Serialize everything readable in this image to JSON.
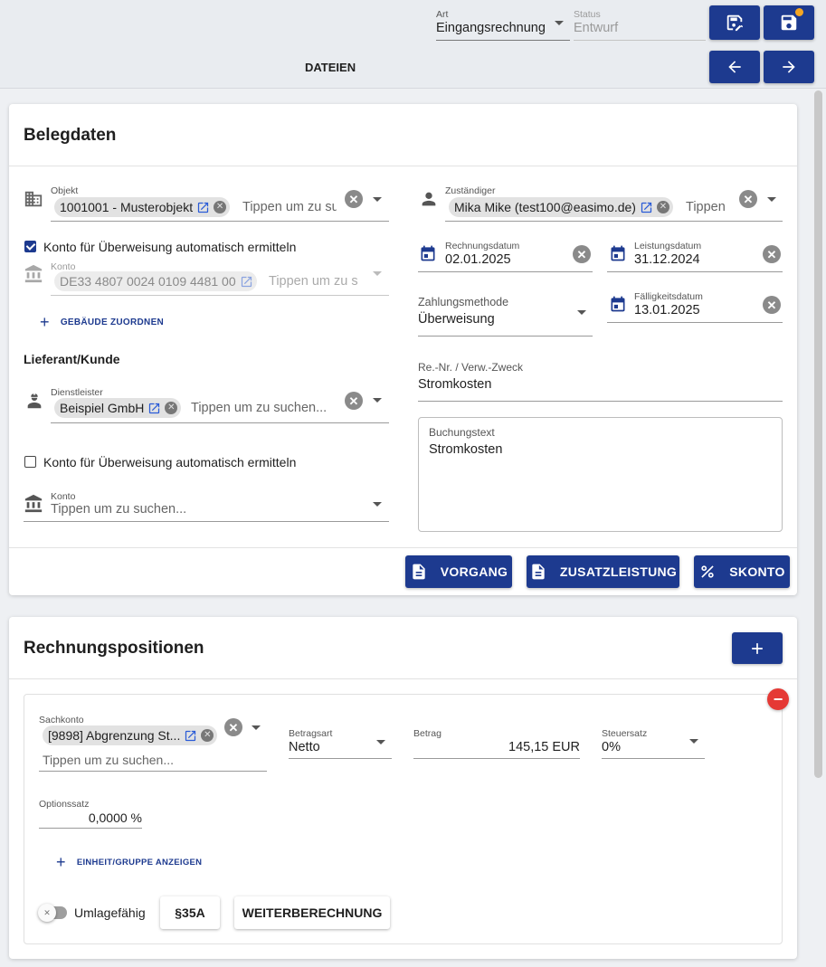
{
  "header": {
    "art_label": "Art",
    "art_value": "Eingangsrechnung",
    "status_label": "Status",
    "status_value": "Entwurf",
    "files_tab": "DATEIEN",
    "unsaved_indicator_color": "#f5a623"
  },
  "belegdaten": {
    "title": "Belegdaten",
    "objekt": {
      "label": "Objekt",
      "chip": "1001001 - Musterobjekt",
      "placeholder": "Tippen um zu su"
    },
    "auto_konto_1": {
      "label": "Konto für Überweisung automatisch ermitteln",
      "checked": true
    },
    "konto_1": {
      "label": "Konto",
      "chip": "DE33 4807 0024 0109 4481 00",
      "placeholder": "Tippen um zu s"
    },
    "gebaeude_btn": "GEBÄUDE ZUORDNEN",
    "lieferant_heading": "Lieferant/Kunde",
    "dienstleister": {
      "label": "Dienstleister",
      "chip": "Beispiel GmbH",
      "placeholder": "Tippen um zu suchen..."
    },
    "auto_konto_2": {
      "label": "Konto für Überweisung automatisch ermitteln",
      "checked": false
    },
    "konto_2": {
      "label": "Konto",
      "placeholder": "Tippen um zu suchen..."
    },
    "zustaendiger": {
      "label": "Zuständiger",
      "chip": "Mika Mike (test100@easimo.de)",
      "placeholder": "Tippen"
    },
    "rechnungsdatum": {
      "label": "Rechnungsdatum",
      "value": "02.01.2025"
    },
    "leistungsdatum": {
      "label": "Leistungsdatum",
      "value": "31.12.2024"
    },
    "zahlungsmethode": {
      "label": "Zahlungsmethode",
      "value": "Überweisung"
    },
    "faelligkeitsdatum": {
      "label": "Fälligkeitsdatum",
      "value": "13.01.2025"
    },
    "re_nr": {
      "label": "Re.-Nr. / Verw.-Zweck",
      "value": "Stromkosten"
    },
    "buchungstext": {
      "label": "Buchungstext",
      "value": "Stromkosten"
    },
    "buttons": {
      "vorgang": "VORGANG",
      "zusatzleistung": "ZUSATZLEISTUNG",
      "skonto": "SKONTO"
    }
  },
  "positionen": {
    "title": "Rechnungspositionen",
    "sachkonto": {
      "label": "Sachkonto",
      "chip": "[9898] Abgrenzung St...",
      "placeholder": "Tippen um zu suchen..."
    },
    "betragsart": {
      "label": "Betragsart",
      "value": "Netto"
    },
    "betrag": {
      "label": "Betrag",
      "value": "145,15 EUR"
    },
    "steuersatz": {
      "label": "Steuersatz",
      "value": "0%"
    },
    "optionssatz": {
      "label": "Optionssatz",
      "value": "0,0000 %"
    },
    "einheit_btn": "EINHEIT/GRUPPE ANZEIGEN",
    "umlagefaehig": {
      "label": "Umlagefähig",
      "on": false
    },
    "btn_35a": "§35A",
    "btn_weiter": "WEITERBERECHNUNG"
  },
  "colors": {
    "primary": "#1d3a8f",
    "remove_red": "#e53935"
  }
}
